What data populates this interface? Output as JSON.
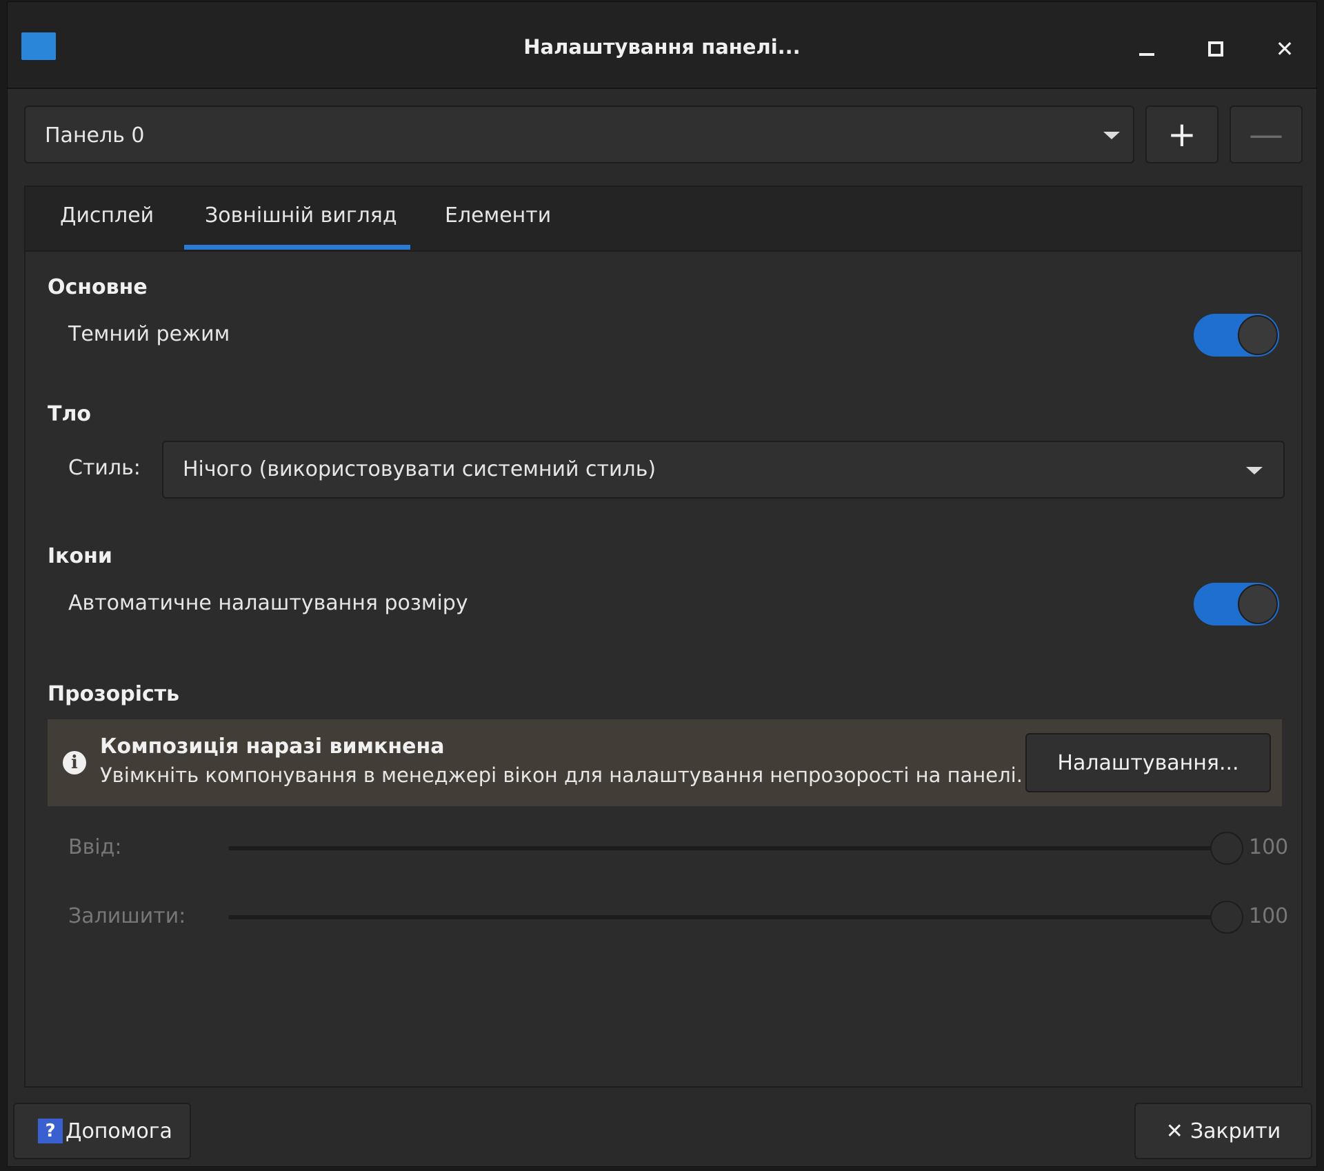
{
  "window": {
    "title": "Налаштування панелі...",
    "minimize_icon": "minimize-icon",
    "maximize_icon": "maximize-icon",
    "close_glyph": "✕"
  },
  "panel_selector": {
    "value": "Панель 0",
    "add_glyph": "+",
    "remove_glyph": "—"
  },
  "tabs": [
    {
      "label": "Дисплей",
      "active": false
    },
    {
      "label": "Зовнішній вигляд",
      "active": true
    },
    {
      "label": "Елементи",
      "active": false
    }
  ],
  "sections": {
    "general": {
      "title": "Основне",
      "dark_mode_label": "Темний режим",
      "dark_mode_on": true
    },
    "background": {
      "title": "Тло",
      "style_label": "Стиль:",
      "style_value": "Нічого (використовувати системний стиль)"
    },
    "icons": {
      "title": "Ікони",
      "auto_size_label": "Автоматичне налаштування розміру",
      "auto_size_on": true
    },
    "opacity": {
      "title": "Прозорість",
      "info_title": "Композиція наразі вимкнена",
      "info_text": "Увімкніть компонування в менеджері вікон для налаштування непрозорості на панелі.",
      "settings_button": "Налаштування...",
      "enter_label": "Ввід:",
      "enter_value": "100",
      "leave_label": "Залишити:",
      "leave_value": "100"
    }
  },
  "footer": {
    "help_glyph": "?",
    "help_label": "Допомога",
    "close_glyph": "✕",
    "close_label": "Закрити"
  },
  "colors": {
    "accent": "#2a7bd6",
    "switch_on": "#1f6fd1",
    "info_bg": "#423d36",
    "window_bg": "#2a2a2a"
  }
}
